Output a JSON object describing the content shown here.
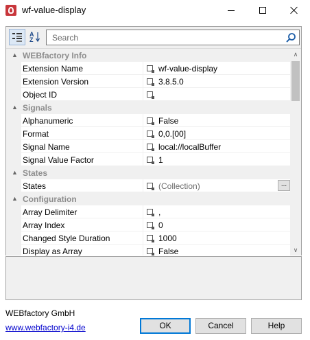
{
  "window": {
    "title": "wf-value-display",
    "icon": "webfactory-app-icon"
  },
  "toolbar": {
    "categorized_icon": "categorized-view-icon",
    "alphabetical_icon": "alphabetical-sort-icon",
    "alpha_glyph_top": "A",
    "alpha_glyph_bottom": "Z",
    "search_placeholder": "Search"
  },
  "grid": {
    "categories": [
      {
        "label": "WEBfactory Info",
        "toggle": "▲",
        "properties": [
          {
            "name": "Extension Name",
            "value": "wf-value-display"
          },
          {
            "name": "Extension Version",
            "value": "3.8.5.0"
          },
          {
            "name": "Object ID",
            "value": ""
          }
        ]
      },
      {
        "label": "Signals",
        "toggle": "▲",
        "properties": [
          {
            "name": "Alphanumeric",
            "value": "False"
          },
          {
            "name": "Format",
            "value": "0,0.[00]"
          },
          {
            "name": "Signal Name",
            "value": "local://localBuffer"
          },
          {
            "name": "Signal Value Factor",
            "value": "1"
          }
        ]
      },
      {
        "label": "States",
        "toggle": "▲",
        "properties": [
          {
            "name": "States",
            "value": "(Collection)",
            "button": "..."
          }
        ]
      },
      {
        "label": "Configuration",
        "toggle": "▲",
        "properties": [
          {
            "name": "Array Delimiter",
            "value": ","
          },
          {
            "name": "Array Index",
            "value": "0"
          },
          {
            "name": "Changed Style Duration",
            "value": "1000"
          },
          {
            "name": "Display as Array",
            "value": "False"
          }
        ]
      }
    ],
    "scroll_up": "∧",
    "scroll_down": "∨"
  },
  "footer": {
    "company": "WEBfactory GmbH",
    "link": "www.webfactory-i4.de",
    "ok_label": "OK",
    "cancel_label": "Cancel",
    "help_label": "Help"
  },
  "colors": {
    "category_text": "#8d8d8d",
    "panel_bg": "#f0f0f0",
    "accent": "#0078d7",
    "link": "#0000cc"
  }
}
